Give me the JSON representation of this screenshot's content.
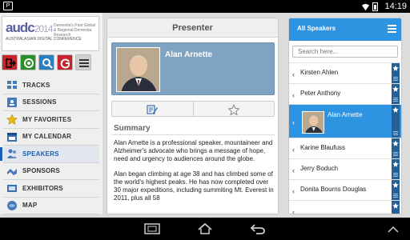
{
  "status_bar": {
    "time": "14:19",
    "notification_badge": "P"
  },
  "logo": {
    "brand": "audc",
    "year": "2014",
    "tagline": "AUSTRALASIAN DIGITAL CONFERENCE",
    "subtitle": "Dementia's Past Global & Regional Dementia Research"
  },
  "toolbar": {
    "buttons": [
      "exit-icon",
      "refresh-icon",
      "search-icon",
      "google-plus-icon",
      "menu-icon"
    ]
  },
  "sidebar": {
    "items": [
      {
        "label": "TRACKS",
        "icon": "tracks-icon",
        "active": false
      },
      {
        "label": "SESSIONS",
        "icon": "sessions-icon",
        "active": false
      },
      {
        "label": "MY FAVORITES",
        "icon": "star-icon",
        "active": false
      },
      {
        "label": "MY CALENDAR",
        "icon": "calendar-icon",
        "active": false
      },
      {
        "label": "SPEAKERS",
        "icon": "speakers-icon",
        "active": true
      },
      {
        "label": "SPONSORS",
        "icon": "sponsors-icon",
        "active": false
      },
      {
        "label": "EXHIBITORS",
        "icon": "exhibitors-icon",
        "active": false
      },
      {
        "label": "MAP",
        "icon": "map-icon",
        "active": false
      }
    ]
  },
  "presenter": {
    "header": "Presenter",
    "name": "Alan Arnette",
    "summary_title": "Summary",
    "summary_paragraphs": [
      "Alan Arnette is a professional speaker, mountaineer and Alzheimer's advocate who brings a message of hope, need and urgency to audiences around the globe.",
      "Alan began climbing at age 38 and has climbed some of the world's highest peaks. He has now completed over 30 major expeditions, including summiting Mt. Everest in 2011, plus all 58"
    ]
  },
  "speakers": {
    "header": "All Speakers",
    "search_placeholder": "Search here...",
    "list": [
      {
        "name": "Kirsten Ahlen",
        "selected": false
      },
      {
        "name": "Peter Anthony",
        "selected": false
      },
      {
        "name": "Alan Arnette",
        "selected": true
      },
      {
        "name": "Karine Blaufuss",
        "selected": false
      },
      {
        "name": "Jerry Boduch",
        "selected": false
      },
      {
        "name": "Donita Bourns Douglas",
        "selected": false
      },
      {
        "name": "",
        "selected": false
      }
    ]
  },
  "colors": {
    "accent": "#2e93e0",
    "card": "#7fa3c2",
    "logo_purple": "#5a5fa0"
  }
}
